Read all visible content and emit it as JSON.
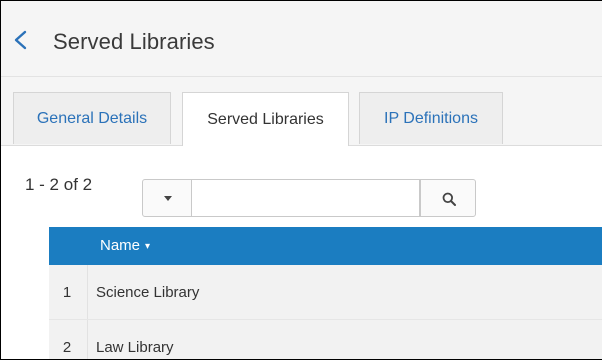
{
  "header": {
    "title": "Served Libraries",
    "back_icon": "chevron-left-icon",
    "accent": "#2b72b9"
  },
  "tabs": [
    {
      "label": "General Details",
      "active": false
    },
    {
      "label": "Served Libraries",
      "active": true
    },
    {
      "label": "IP Definitions",
      "active": false
    }
  ],
  "pager": {
    "text": "1 - 2 of 2"
  },
  "search": {
    "value": "",
    "placeholder": "",
    "filter_icon": "caret-down-icon",
    "search_icon": "search-icon"
  },
  "table": {
    "header_color": "#1b7dc1",
    "columns": [
      {
        "label": "Name",
        "sort_icon": "▾"
      }
    ],
    "rows": [
      {
        "num": "1",
        "name": "Science Library"
      },
      {
        "num": "2",
        "name": "Law Library"
      }
    ]
  }
}
